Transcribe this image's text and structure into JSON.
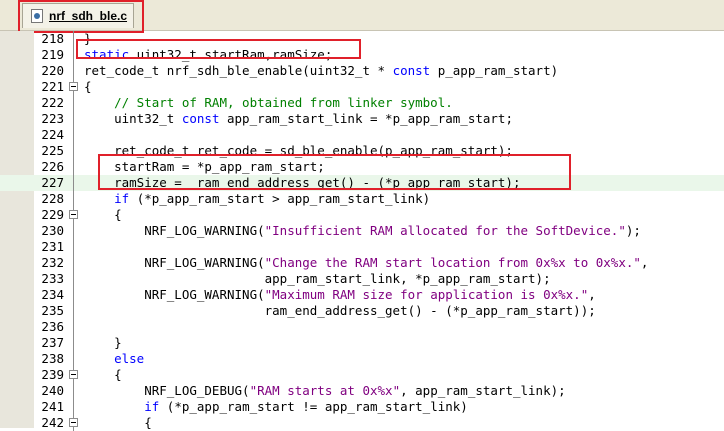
{
  "tab": {
    "label": "nrf_sdh_ble.c"
  },
  "editor": {
    "lines": [
      {
        "num": "218",
        "fold": "line",
        "tokens": [
          {
            "t": "}",
            "c": ""
          }
        ]
      },
      {
        "num": "219",
        "fold": "line",
        "tokens": [
          {
            "t": "static",
            "c": "kw"
          },
          {
            "t": " uint32_t startRam,ramSize;",
            "c": ""
          }
        ]
      },
      {
        "num": "220",
        "fold": "line",
        "tokens": [
          {
            "t": "ret_code_t nrf_sdh_ble_enable(uint32_t * ",
            "c": ""
          },
          {
            "t": "const",
            "c": "kw"
          },
          {
            "t": " p_app_ram_start)",
            "c": ""
          }
        ]
      },
      {
        "num": "221",
        "fold": "box",
        "tokens": [
          {
            "t": "{",
            "c": ""
          }
        ]
      },
      {
        "num": "222",
        "fold": "line",
        "tokens": [
          {
            "t": "    // Start of RAM, obtained from linker symbol.",
            "c": "cm"
          }
        ]
      },
      {
        "num": "223",
        "fold": "line",
        "tokens": [
          {
            "t": "    uint32_t ",
            "c": ""
          },
          {
            "t": "const",
            "c": "kw"
          },
          {
            "t": " app_ram_start_link = *p_app_ram_start;",
            "c": ""
          }
        ]
      },
      {
        "num": "224",
        "fold": "line",
        "tokens": [
          {
            "t": "",
            "c": ""
          }
        ]
      },
      {
        "num": "225",
        "fold": "line",
        "tokens": [
          {
            "t": "    ret_code_t ret_code = sd_ble_enable(p_app_ram_start);",
            "c": ""
          }
        ]
      },
      {
        "num": "226",
        "fold": "line",
        "tokens": [
          {
            "t": "    startRam = *p_app_ram_start;",
            "c": ""
          }
        ]
      },
      {
        "num": "227",
        "fold": "line",
        "current": true,
        "tokens": [
          {
            "t": "    ramSize =  ram_end_address_get() - (*p_app_ram_start);",
            "c": ""
          }
        ]
      },
      {
        "num": "228",
        "fold": "line",
        "tokens": [
          {
            "t": "    ",
            "c": ""
          },
          {
            "t": "if",
            "c": "kw"
          },
          {
            "t": " (*p_app_ram_start > app_ram_start_link)",
            "c": ""
          }
        ]
      },
      {
        "num": "229",
        "fold": "box",
        "tokens": [
          {
            "t": "    {",
            "c": ""
          }
        ]
      },
      {
        "num": "230",
        "fold": "line",
        "tokens": [
          {
            "t": "        NRF_LOG_WARNING(",
            "c": ""
          },
          {
            "t": "\"Insufficient RAM allocated for the SoftDevice.\"",
            "c": "st"
          },
          {
            "t": ");",
            "c": ""
          }
        ]
      },
      {
        "num": "231",
        "fold": "line",
        "tokens": [
          {
            "t": "",
            "c": ""
          }
        ]
      },
      {
        "num": "232",
        "fold": "line",
        "tokens": [
          {
            "t": "        NRF_LOG_WARNING(",
            "c": ""
          },
          {
            "t": "\"Change the RAM start location from 0x%x to 0x%x.\"",
            "c": "st"
          },
          {
            "t": ",",
            "c": ""
          }
        ]
      },
      {
        "num": "233",
        "fold": "line",
        "tokens": [
          {
            "t": "                        app_ram_start_link, *p_app_ram_start);",
            "c": ""
          }
        ]
      },
      {
        "num": "234",
        "fold": "line",
        "tokens": [
          {
            "t": "        NRF_LOG_WARNING(",
            "c": ""
          },
          {
            "t": "\"Maximum RAM size for application is 0x%x.\"",
            "c": "st"
          },
          {
            "t": ",",
            "c": ""
          }
        ]
      },
      {
        "num": "235",
        "fold": "line",
        "tokens": [
          {
            "t": "                        ram_end_address_get() - (*p_app_ram_start));",
            "c": ""
          }
        ]
      },
      {
        "num": "236",
        "fold": "line",
        "tokens": [
          {
            "t": "",
            "c": ""
          }
        ]
      },
      {
        "num": "237",
        "fold": "line",
        "tokens": [
          {
            "t": "    }",
            "c": ""
          }
        ]
      },
      {
        "num": "238",
        "fold": "line",
        "tokens": [
          {
            "t": "    ",
            "c": ""
          },
          {
            "t": "else",
            "c": "kw"
          }
        ]
      },
      {
        "num": "239",
        "fold": "box",
        "tokens": [
          {
            "t": "    {",
            "c": ""
          }
        ]
      },
      {
        "num": "240",
        "fold": "line",
        "tokens": [
          {
            "t": "        NRF_LOG_DEBUG(",
            "c": ""
          },
          {
            "t": "\"RAM starts at 0x%x\"",
            "c": "st"
          },
          {
            "t": ", app_ram_start_link);",
            "c": ""
          }
        ]
      },
      {
        "num": "241",
        "fold": "line",
        "tokens": [
          {
            "t": "        ",
            "c": ""
          },
          {
            "t": "if",
            "c": "kw"
          },
          {
            "t": " (*p_app_ram_start != app_ram_start_link)",
            "c": ""
          }
        ]
      },
      {
        "num": "242",
        "fold": "box",
        "tokens": [
          {
            "t": "        {",
            "c": ""
          }
        ]
      }
    ]
  },
  "colors": {
    "keyword": "#0000ff",
    "comment": "#008000",
    "string": "#800080",
    "highlight_box": "#e0202a",
    "current_line": "#eaf7ea"
  }
}
